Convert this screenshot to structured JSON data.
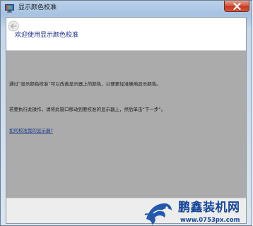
{
  "window": {
    "title": "显示颜色校准",
    "app_icon": "display-color-calibration-icon",
    "close_icon": "close-icon"
  },
  "header": {
    "back_icon": "back-arrow-icon",
    "heading": "欢迎使用显示颜色校准"
  },
  "body": {
    "paragraph_1": "通过“显示颜色校准”可以改善显示器上的颜色，以便更加准确地显示颜色。",
    "paragraph_2": "若要执行此操作，请将此窗口移动到要校准的显示器上，然后单击“下一步”。",
    "help_link": "如何校准我的显示器?"
  },
  "watermark": {
    "name": "鹏鑫装机网",
    "url": "www.0753px.com",
    "logo_icon": "dragon-logo-icon"
  },
  "colors": {
    "title_bar": "#b9d1ea",
    "content_bg": "#ababab",
    "heading": "#1e3287",
    "link": "#1d3b8c",
    "close_button": "#c4381f",
    "watermark": "#17479a"
  }
}
